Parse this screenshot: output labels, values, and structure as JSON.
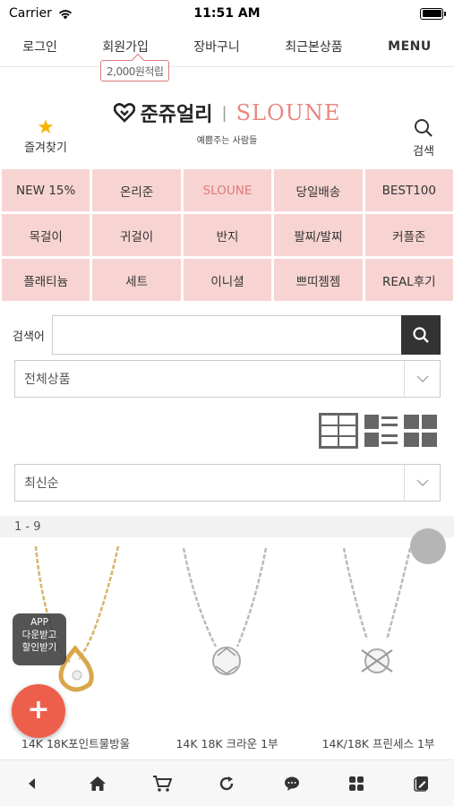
{
  "status_bar": {
    "carrier": "Carrier",
    "time": "11:51 AM"
  },
  "top_nav": {
    "login": "로그인",
    "signup": "회원가입",
    "cart": "장바구니",
    "recent": "최근본상품",
    "menu": "MENU"
  },
  "points_badge": "2,000원적립",
  "header": {
    "favorites_label": "즐겨찾기",
    "logo_ko": "준쥬얼리",
    "logo_sep": "|",
    "logo_en": "SLOUNE",
    "tagline": "예쁨주는 사람들",
    "search_label": "검색"
  },
  "categories": [
    "NEW 15%",
    "온리준",
    "SLOUNE",
    "당일배송",
    "BEST100",
    "목걸이",
    "귀걸이",
    "반지",
    "팔찌/발찌",
    "커플존",
    "플래티늄",
    "세트",
    "이니셜",
    "쁘띠젬젬",
    "REAL후기"
  ],
  "search": {
    "label": "검색어",
    "value": ""
  },
  "filter_select": "전체상품",
  "sort_select": "최신순",
  "result_count": "1 - 9",
  "products": [
    {
      "name": "14K 18K포인트물방울"
    },
    {
      "name": "14K 18K 크라운 1부"
    },
    {
      "name": "14K/18K 프린세스 1부"
    }
  ],
  "app_badge": {
    "line1": "APP",
    "line2": "다운받고",
    "line3": "할인받기"
  },
  "fab_label": "+",
  "colors": {
    "accent": "#e07a7a",
    "category_bg": "#f7d4d2",
    "fab": "#ee5f4b",
    "logo_en": "#e8877f"
  },
  "bottom_bar_icons": [
    "back-icon",
    "home-icon",
    "cart-icon",
    "refresh-icon",
    "chat-icon",
    "apps-icon",
    "edit-icon"
  ]
}
